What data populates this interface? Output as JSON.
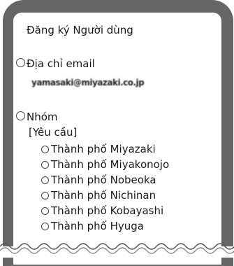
{
  "form": {
    "title": "Đăng ký Người dùng",
    "email": {
      "label": "Địa chỉ email",
      "value": "yamasaki@miyazaki.co.jp"
    },
    "group": {
      "label": "Nhóm",
      "required": "[Yêu cầu]",
      "options": [
        "Thành phố Miyazaki",
        "Thành phố Miyakonojo",
        "Thành phố Nobeoka",
        "Thành phố Nichinan",
        "Thành phố Kobayashi",
        "Thành phố Hyuga"
      ]
    }
  },
  "colors": {
    "frame": "#666666",
    "panel": "#ffffff"
  }
}
